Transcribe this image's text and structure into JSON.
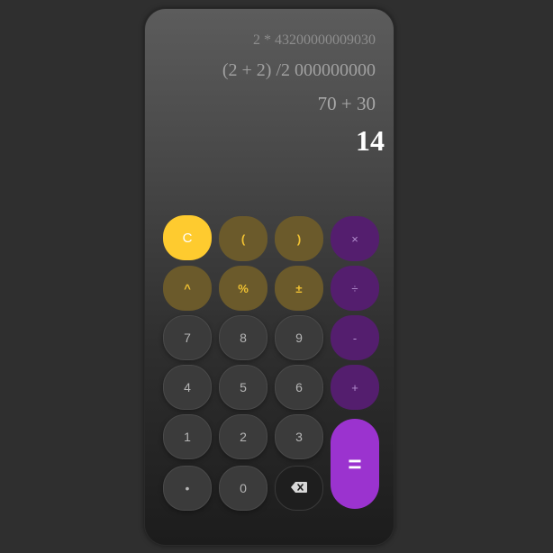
{
  "display": {
    "history": [
      "2 * 43200000009030",
      "(2 + 2) /2 000000000",
      "70 + 30"
    ],
    "result": "14"
  },
  "buttons": {
    "clear": "C",
    "open_paren": "(",
    "close_paren": ")",
    "multiply": "×",
    "power": "^",
    "percent": "%",
    "plus_minus": "±",
    "divide": "÷",
    "seven": "7",
    "eight": "8",
    "nine": "9",
    "minus": "-",
    "four": "4",
    "five": "5",
    "six": "6",
    "plus": "+",
    "one": "1",
    "two": "2",
    "three": "3",
    "equals": "=",
    "decimal": "•",
    "zero": "0",
    "backspace_icon": "backspace-icon"
  },
  "colors": {
    "clear": "#fecb2f",
    "function": "#6b5a2b",
    "operator": "#541e6e",
    "equals": "#9b33cf"
  }
}
